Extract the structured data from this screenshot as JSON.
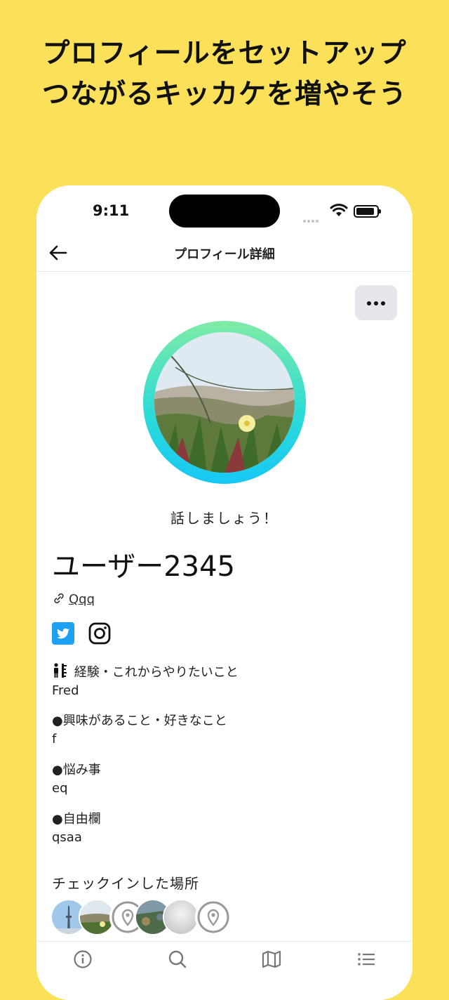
{
  "headline": {
    "line1": "プロフィールをセットアップ",
    "line2": "つながるキッカケを増やそう"
  },
  "status_bar": {
    "time": "9:11"
  },
  "navbar": {
    "title": "プロフィール詳細",
    "back_icon": "arrow-left-icon"
  },
  "profile": {
    "greeting": "話しましょう！",
    "username": "ユーザー2345",
    "link_text": "Qqq",
    "social": [
      "twitter-icon",
      "instagram-icon"
    ]
  },
  "sections": [
    {
      "label": "経験・これからやりたいこと",
      "value": "Fred"
    },
    {
      "label": "●興味があること・好きなこと",
      "value": "f"
    },
    {
      "label": "●悩み事",
      "value": "eq"
    },
    {
      "label": "●自由欄",
      "value": "qsaa"
    }
  ],
  "checkins": {
    "title": "チェックインした場所",
    "items": [
      "tower-photo",
      "dune-photo",
      "pin-icon",
      "garden-photo",
      "blur-photo",
      "pin-icon"
    ]
  },
  "tabbar": {
    "items": [
      "info-icon",
      "search-icon",
      "map-icon",
      "list-icon"
    ]
  },
  "colors": {
    "background": "#FBE05A",
    "ring_top": "#7FEBA5",
    "ring_bottom": "#17C8F5",
    "twitter": "#1DA1F2"
  }
}
